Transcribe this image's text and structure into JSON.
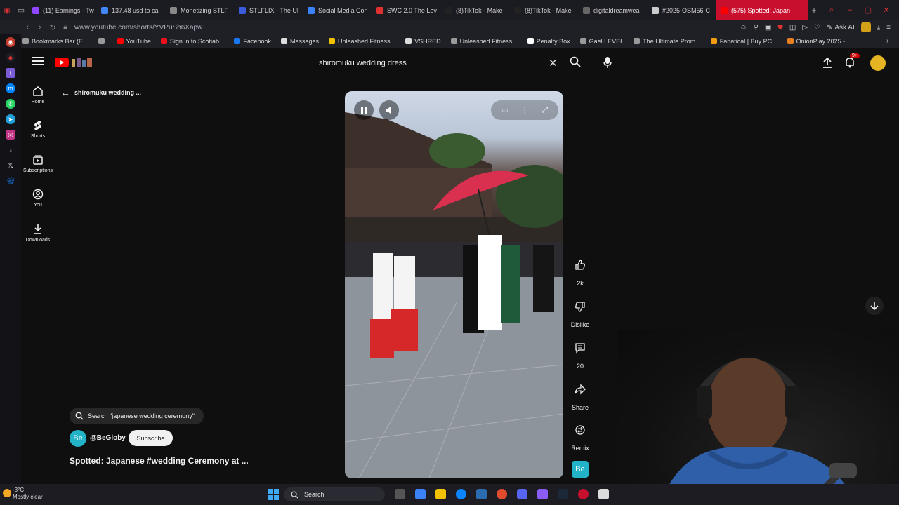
{
  "browser": {
    "tabs": [
      {
        "title": "(11) Earnings - Tw",
        "color": "#9146ff"
      },
      {
        "title": "137.48 usd to ca",
        "color": "#4285f4"
      },
      {
        "title": "Monetizing STLF",
        "color": "#888888"
      },
      {
        "title": "STLFLIX - The Ul",
        "color": "#3b5bdb"
      },
      {
        "title": "Social Media Con",
        "color": "#3b82f6"
      },
      {
        "title": "SWC 2.0 The Lev",
        "color": "#e03131"
      },
      {
        "title": "(8)TikTok - Make",
        "color": "#222222"
      },
      {
        "title": "(8)TikTok - Make",
        "color": "#222222"
      },
      {
        "title": "digitaldreamwea",
        "color": "#666666"
      },
      {
        "title": "#2025-OSM56-C",
        "color": "#cccccc"
      },
      {
        "title": "(575) Spotted: Japan",
        "color": "#ff0000"
      }
    ],
    "url": "www.youtube.com/shorts/YVPuSb6Xapw",
    "ask_ai": "Ask AI",
    "bookmarks": [
      {
        "label": "Bookmarks Bar (E...",
        "color": "#999999"
      },
      {
        "label": "",
        "color": "#999999"
      },
      {
        "label": "YouTube",
        "color": "#ff0000"
      },
      {
        "label": "Sign in to Scotiab...",
        "color": "#ec111a"
      },
      {
        "label": "Facebook",
        "color": "#1877f2"
      },
      {
        "label": "Messages",
        "color": "#dddddd"
      },
      {
        "label": "Unleashed Fitness...",
        "color": "#f2c200"
      },
      {
        "label": "VSHRED",
        "color": "#dddddd"
      },
      {
        "label": "Unleashed Fitness...",
        "color": "#999999"
      },
      {
        "label": "Penalty Box",
        "color": "#ffffff"
      },
      {
        "label": "Gael LEVEL",
        "color": "#999999"
      },
      {
        "label": "The Ultimate Prom...",
        "color": "#999999"
      },
      {
        "label": "Fanatical | Buy PC...",
        "color": "#f39c12"
      },
      {
        "label": "OnionPlay 2025 -...",
        "color": "#e67e22"
      }
    ]
  },
  "youtube": {
    "search_query": "shiromuku wedding dress",
    "notifications_badge": "9+",
    "back_label": "shiromuku wedding ...",
    "guide": [
      {
        "label": "Home",
        "icon": "home-icon"
      },
      {
        "label": "Shorts",
        "icon": "shorts-icon"
      },
      {
        "label": "Subscriptions",
        "icon": "subscriptions-icon"
      },
      {
        "label": "You",
        "icon": "you-icon"
      },
      {
        "label": "Downloads",
        "icon": "downloads-icon"
      }
    ],
    "actions": {
      "like_count": "2k",
      "dislike_label": "Dislike",
      "comment_count": "20",
      "share_label": "Share",
      "remix_label": "Remix"
    },
    "related_search": "Search \"japanese wedding ceremony\"",
    "channel": {
      "avatar_text": "Be",
      "name": "@BeGloby"
    },
    "subscribe_label": "Subscribe",
    "video_title": "Spotted: Japanese #wedding  Ceremony at ...",
    "brand_color": "#ff0000"
  },
  "taskbar": {
    "temperature": "-3°C",
    "weather": "Mostly clear",
    "search_label": "Search"
  }
}
